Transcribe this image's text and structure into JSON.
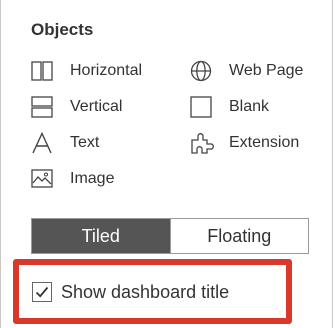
{
  "objects_panel": {
    "title": "Objects",
    "items": [
      {
        "label": "Horizontal",
        "icon": "horizontal-container-icon"
      },
      {
        "label": "Web Page",
        "icon": "globe-icon"
      },
      {
        "label": "Vertical",
        "icon": "vertical-container-icon"
      },
      {
        "label": "Blank",
        "icon": "blank-icon"
      },
      {
        "label": "Text",
        "icon": "text-icon"
      },
      {
        "label": "Extension",
        "icon": "puzzle-icon"
      },
      {
        "label": "Image",
        "icon": "image-icon"
      }
    ]
  },
  "layout_toggle": {
    "options": [
      "Tiled",
      "Floating"
    ],
    "selected": "Tiled"
  },
  "show_title": {
    "label": "Show dashboard title",
    "checked": true
  },
  "colors": {
    "selected_bg": "#555555",
    "highlight": "#d9382a"
  }
}
